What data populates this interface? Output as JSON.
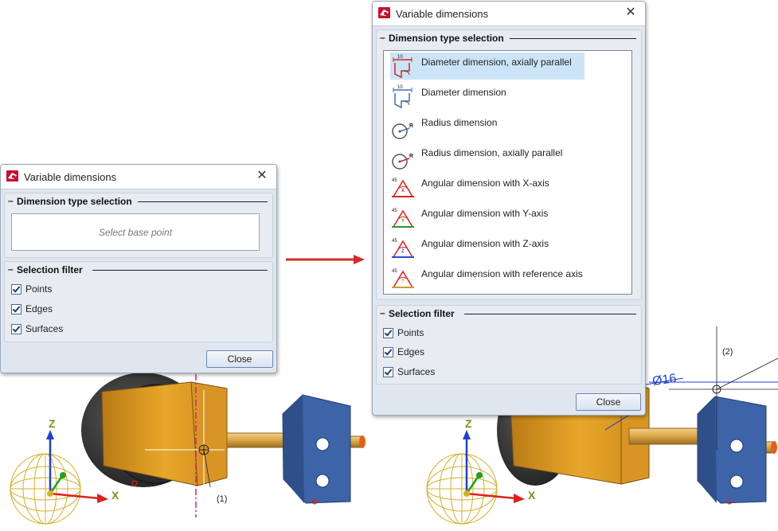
{
  "dialog_left": {
    "title": "Variable dimensions",
    "close_symbol": "✕",
    "type_group": {
      "title": "Dimension type selection",
      "placeholder": "Select base point"
    },
    "filter_group": {
      "title": "Selection filter",
      "items": [
        {
          "label": "Points",
          "checked": true
        },
        {
          "label": "Edges",
          "checked": true
        },
        {
          "label": "Surfaces",
          "checked": true
        }
      ]
    },
    "close_button": "Close"
  },
  "dialog_right": {
    "title": "Variable dimensions",
    "close_symbol": "✕",
    "type_group": {
      "title": "Dimension type selection",
      "items": [
        {
          "label": "Diameter dimension, axially parallel",
          "icon": "diameter-axial-icon",
          "selected": true
        },
        {
          "label": "Diameter dimension",
          "icon": "diameter-icon",
          "selected": false
        },
        {
          "label": "Radius dimension",
          "icon": "radius-icon",
          "selected": false
        },
        {
          "label": "Radius dimension, axially parallel",
          "icon": "radius-axial-icon",
          "selected": false
        },
        {
          "label": "Angular dimension with X-axis",
          "icon": "angle-x-icon",
          "selected": false
        },
        {
          "label": "Angular dimension with Y-axis",
          "icon": "angle-y-icon",
          "selected": false
        },
        {
          "label": "Angular dimension with Z-axis",
          "icon": "angle-z-icon",
          "selected": false
        },
        {
          "label": "Angular dimension with reference axis",
          "icon": "angle-ref-icon",
          "selected": false
        }
      ]
    },
    "filter_group": {
      "title": "Selection filter",
      "items": [
        {
          "label": "Points",
          "checked": true
        },
        {
          "label": "Edges",
          "checked": true
        },
        {
          "label": "Surfaces",
          "checked": true
        }
      ]
    },
    "close_button": "Close"
  },
  "viewport_left": {
    "axis_z": "Z",
    "axis_x": "X",
    "point_label": "(1)"
  },
  "viewport_right": {
    "axis_z": "Z",
    "axis_x": "X",
    "point_label": "(2)",
    "dimension_text": "Ø16"
  },
  "colors": {
    "part_orange": "#e8a72a",
    "part_blue": "#3d64a8",
    "wheel_dark": "#3a3a3a",
    "axis_red": "#e02020",
    "axis_green": "#20a020",
    "axis_blue": "#2040d0",
    "arrow_red": "#d42a2a",
    "centerline_magenta": "#d0208a",
    "selection_highlight": "#cce4f7"
  }
}
